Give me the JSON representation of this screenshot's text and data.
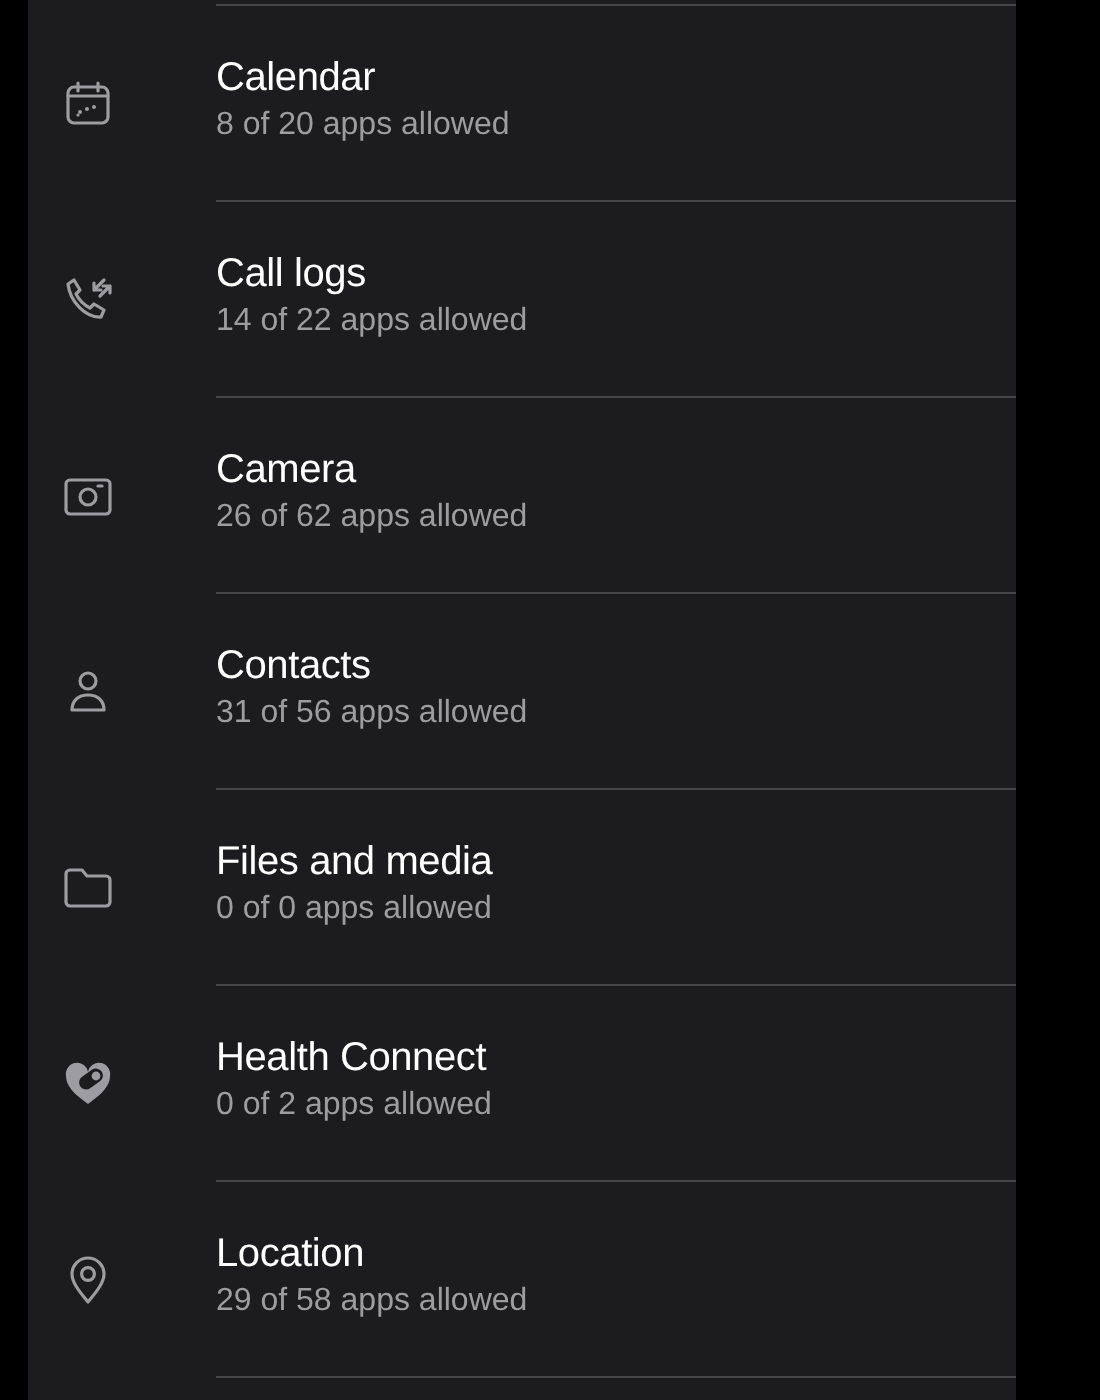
{
  "permissions": [
    {
      "title": "Calendar",
      "summary": "8 of 20 apps allowed"
    },
    {
      "title": "Call logs",
      "summary": "14 of 22 apps allowed"
    },
    {
      "title": "Camera",
      "summary": "26 of 62 apps allowed"
    },
    {
      "title": "Contacts",
      "summary": "31 of 56 apps allowed"
    },
    {
      "title": "Files and media",
      "summary": "0 of 0 apps allowed"
    },
    {
      "title": "Health Connect",
      "summary": "0 of 2 apps allowed"
    },
    {
      "title": "Location",
      "summary": "29 of 58 apps allowed"
    }
  ]
}
